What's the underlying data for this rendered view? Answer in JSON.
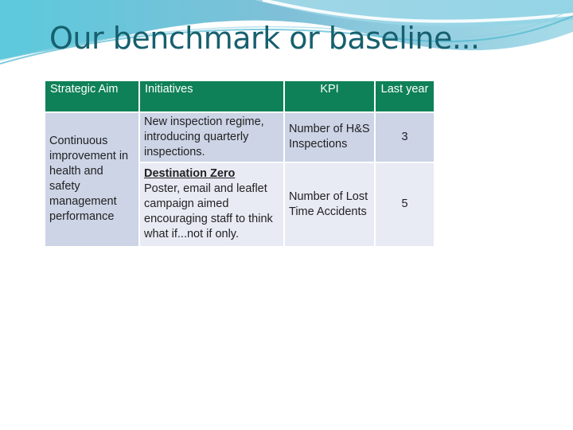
{
  "slide": {
    "title": "Our benchmark or baseline...",
    "colors": {
      "title": "#17606e",
      "header_bg": "#0f8158",
      "row_dark": "#ccd4e6",
      "row_light": "#e8ebf4"
    }
  },
  "table": {
    "headers": {
      "strategic_aim": "Strategic Aim",
      "initiatives": "Initiatives",
      "kpi": "KPI",
      "last_year": "Last year"
    },
    "strategic_aim": "Continuous improvement in health and safety management performance",
    "rows": [
      {
        "initiative_heading": "",
        "initiative": "New inspection regime, introducing quarterly inspections.",
        "kpi": "Number of H&S Inspections",
        "last_year": "3"
      },
      {
        "initiative_heading": "Destination Zero",
        "initiative": "Poster, email and leaflet campaign aimed encouraging staff to think what if...not if only.",
        "kpi": "Number of Lost Time Accidents",
        "last_year": "5"
      }
    ]
  }
}
